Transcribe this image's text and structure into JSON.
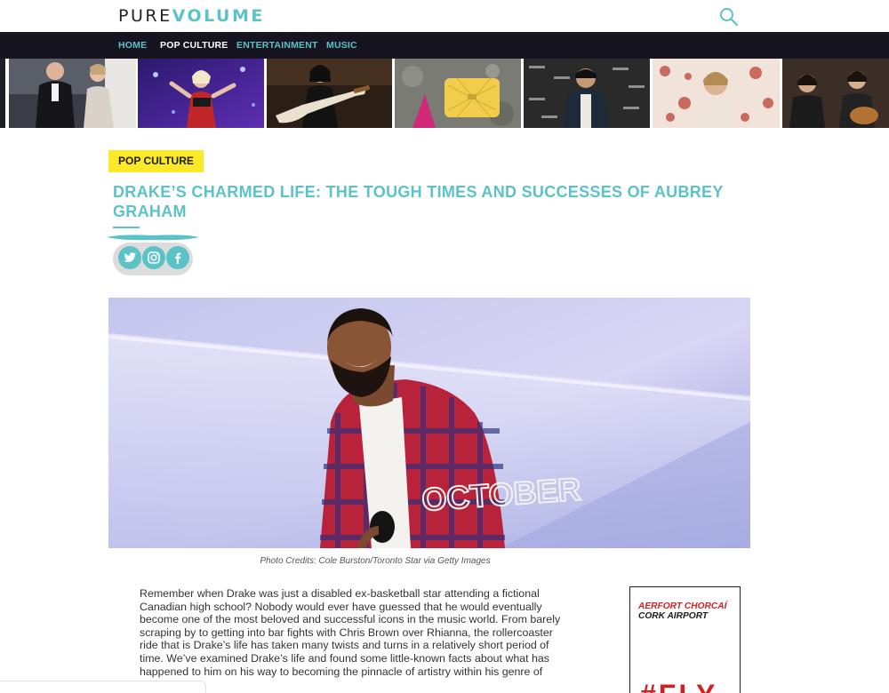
{
  "header": {
    "logo_part1": "PURE",
    "logo_part2": "VOLUME",
    "search_icon": "search-icon"
  },
  "nav": {
    "items": [
      {
        "label": "HOME",
        "color": "#5bc3c8"
      },
      {
        "label": "POP CULTURE",
        "color": "#ffffff"
      },
      {
        "label": "ENTERTAINMENT",
        "color": "#5bc3c8"
      },
      {
        "label": "MUSIC",
        "color": "#5bc3c8"
      }
    ]
  },
  "thumbnails": [
    {
      "subject": "couple at red carpet event"
    },
    {
      "subject": "singer performing on stage"
    },
    {
      "subject": "guitarist performing"
    },
    {
      "subject": "yellow quilted handbag"
    },
    {
      "subject": "man at press backdrop"
    },
    {
      "subject": "man on floral pattern"
    },
    {
      "subject": "band with guitars"
    }
  ],
  "article": {
    "category": "POP CULTURE",
    "title": "DRAKE’S CHARMED LIFE: THE TOUGH TIMES AND SUCCESSES OF AUBREY GRAHAM",
    "share_icons": [
      "twitter-icon",
      "instagram-icon",
      "facebook-icon"
    ],
    "photo_credit": "Photo Credits: Cole Burston/Toronto Star via Getty Images",
    "hero_shirt_text": "OCTOBER",
    "body_lines": [
      "Remember when Drake was just a disabled ex-basketball star attending a fictional",
      "Canadian high school? Nobody would ever have guessed that he would eventually",
      "become one of the most beloved and successful icons in the music world. From barely",
      "scraping by to getting into bar fights with Chris Brown over Rhianna, the rollercoaster",
      "ride that is Drake’s life has taken many twists and turns in a relatively short period of",
      "time. We’ve examined Drake’s life and found some little-known facts about what has",
      "happened to him on his way to becoming the pinnacle of artistry within his genre of"
    ]
  },
  "ad": {
    "line1": "AERFORT CHORCAÍ",
    "line2": "CORK AIRPORT",
    "big_text": "#FLY"
  },
  "colors": {
    "accent": "#5bc3c8",
    "nav_bg": "#16141f",
    "tag_bg": "#fbe826",
    "ad_red": "#d21f26"
  }
}
